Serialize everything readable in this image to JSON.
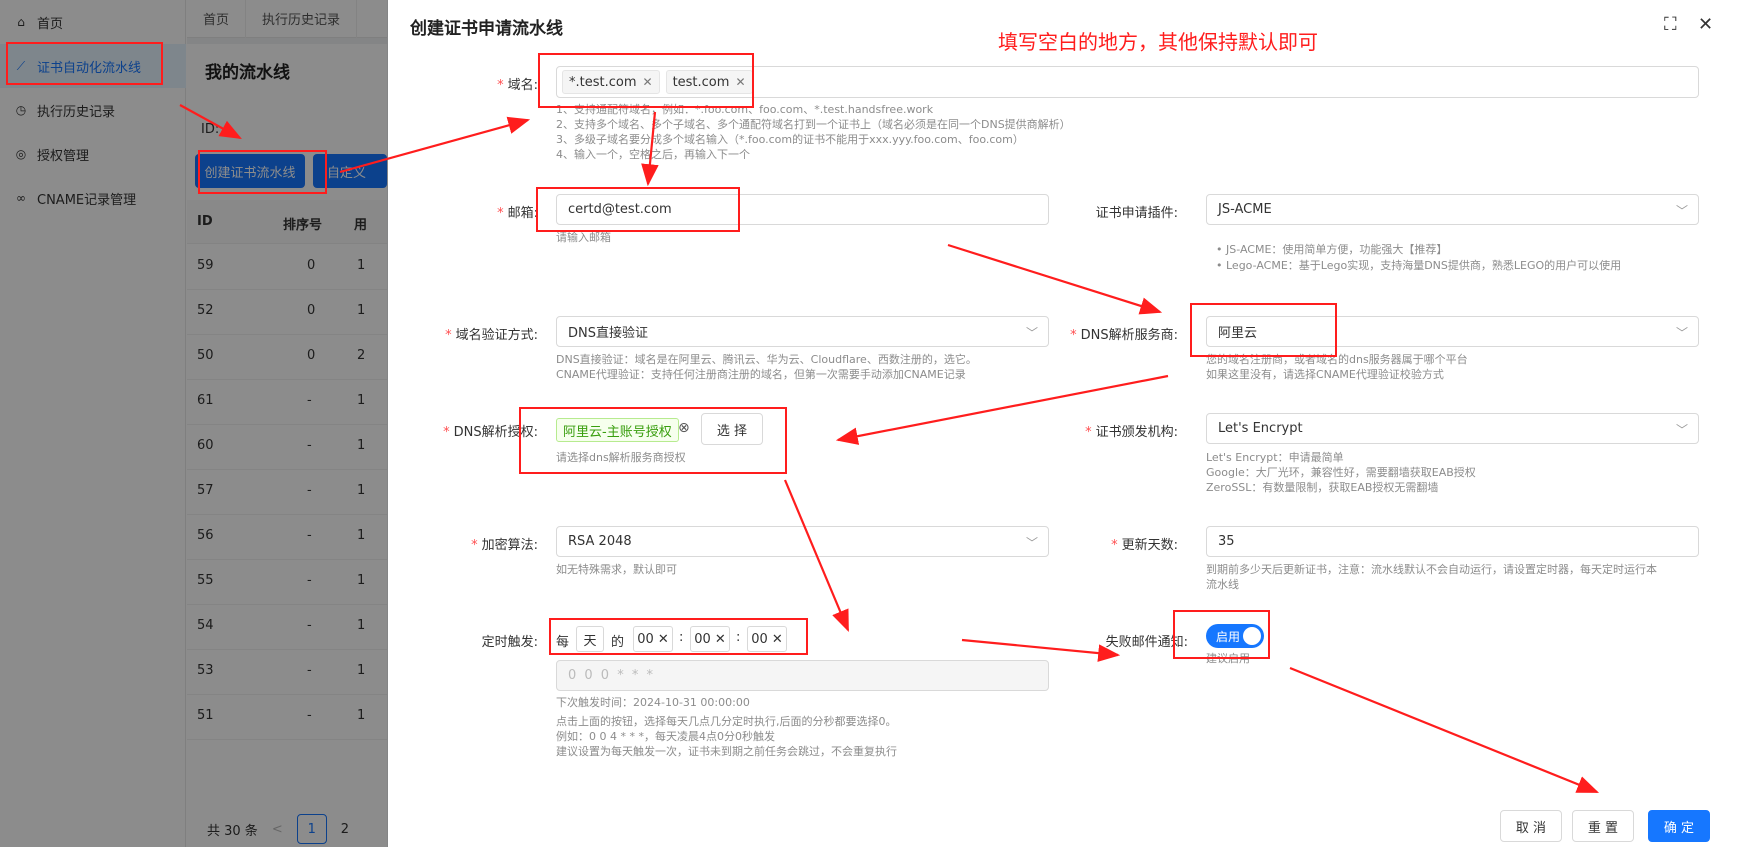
{
  "sidebar": {
    "items": [
      {
        "label": "首页",
        "icon": "home-icon",
        "glyph": "⌂"
      },
      {
        "label": "证书自动化流水线",
        "icon": "chart-line-icon",
        "glyph": "⟋"
      },
      {
        "label": "执行历史记录",
        "icon": "history-icon",
        "glyph": "◷"
      },
      {
        "label": "授权管理",
        "icon": "target-icon",
        "glyph": "◎"
      },
      {
        "label": "CNAME记录管理",
        "icon": "link-icon",
        "glyph": "∞"
      }
    ]
  },
  "tabs": [
    "首页",
    "执行历史记录"
  ],
  "background": {
    "page_title": "我的流水线",
    "id_label": "ID:",
    "create_button": "创建证书流水线",
    "custom_button": "自定义",
    "columns": [
      "ID",
      "排序号",
      "用"
    ],
    "rows": [
      [
        "59",
        "0",
        "1"
      ],
      [
        "52",
        "0",
        "1"
      ],
      [
        "50",
        "0",
        "2"
      ],
      [
        "61",
        "-",
        "1"
      ],
      [
        "60",
        "-",
        "1"
      ],
      [
        "57",
        "-",
        "1"
      ],
      [
        "56",
        "-",
        "1"
      ],
      [
        "55",
        "-",
        "1"
      ],
      [
        "54",
        "-",
        "1"
      ],
      [
        "53",
        "-",
        "1"
      ],
      [
        "51",
        "-",
        "1"
      ]
    ],
    "pager": {
      "total": "共 30 条",
      "prev": "<",
      "page1": "1",
      "page2": "2"
    }
  },
  "drawer": {
    "title": "创建证书申请流水线",
    "annotation": "填写空白的地方，其他保持默认即可",
    "domain": {
      "label": "域名:",
      "tags": [
        "*.test.com",
        "test.com"
      ],
      "hints": [
        "1、支持通配符域名，例如：*.foo.com、foo.com、*.test.handsfree.work",
        "2、支持多个域名、多个子域名、多个通配符域名打到一个证书上（域名必须是在同一个DNS提供商解析）",
        "3、多级子域名要分成多个域名输入（*.foo.com的证书不能用于xxx.yyy.foo.com、foo.com）",
        "4、输入一个，空格之后，再输入下一个"
      ]
    },
    "email": {
      "label": "邮箱:",
      "value": "certd@test.com",
      "hint": "请输入邮箱"
    },
    "plugin": {
      "label": "证书申请插件:",
      "value": "JS-ACME",
      "hints": [
        "• JS-ACME：使用简单方便，功能强大【推荐】",
        "• Lego-ACME：基于Lego实现，支持海量DNS提供商，熟悉LEGO的用户可以使用"
      ]
    },
    "verify": {
      "label": "域名验证方式:",
      "value": "DNS直接验证",
      "hints": [
        "DNS直接验证：域名是在阿里云、腾讯云、华为云、Cloudflare、西数注册的，选它。",
        "CNAME代理验证：支持任何注册商注册的域名，但第一次需要手动添加CNAME记录"
      ]
    },
    "dns_provider": {
      "label": "DNS解析服务商:",
      "value": "阿里云",
      "hints": [
        "您的域名注册商，或者域名的dns服务器属于哪个平台",
        "如果这里没有，请选择CNAME代理验证校验方式"
      ]
    },
    "dns_auth": {
      "label": "DNS解析授权:",
      "tag": "阿里云-主账号授权",
      "select": "选 择",
      "hint": "请选择dns解析服务商授权"
    },
    "ca": {
      "label": "证书颁发机构:",
      "value": "Let's Encrypt",
      "hints": [
        "Let's Encrypt：申请最简单",
        "Google：大厂光环，兼容性好，需要翻墙获取EAB授权",
        "ZeroSSL：有数量限制，获取EAB授权无需翻墙"
      ]
    },
    "algo": {
      "label": "加密算法:",
      "value": "RSA 2048",
      "hint": "如无特殊需求，默认即可"
    },
    "renew": {
      "label": "更新天数:",
      "value": "35",
      "hints": [
        "到期前多少天后更新证书，注意：流水线默认不会自动运行，请设置定时器，每天定时运行本",
        "流水线"
      ]
    },
    "cron": {
      "label": "定时触发:",
      "every": "每",
      "unit": "天",
      "of": "的",
      "h": "00",
      "m": "00",
      "s": "00",
      "expr_placeholder": "0 0 0 * * *",
      "next": "下次触发时间：2024-10-31 00:00:00",
      "hints": [
        "点击上面的按钮，选择每天几点几分定时执行,后面的分秒都要选择0。",
        "例如：0 0 4 * * *，每天凌晨4点0分0秒触发",
        "建议设置为每天触发一次，证书未到期之前任务会跳过，不会重复执行"
      ]
    },
    "fail_notice": {
      "label": "失败邮件通知:",
      "toggle": "启用",
      "hint": "建议启用"
    },
    "footer": {
      "cancel": "取 消",
      "reset": "重 置",
      "ok": "确 定"
    }
  },
  "colors": {
    "accent": "#1677ff",
    "annotation": "#ff1d1d",
    "required": "#ff4d4f"
  }
}
